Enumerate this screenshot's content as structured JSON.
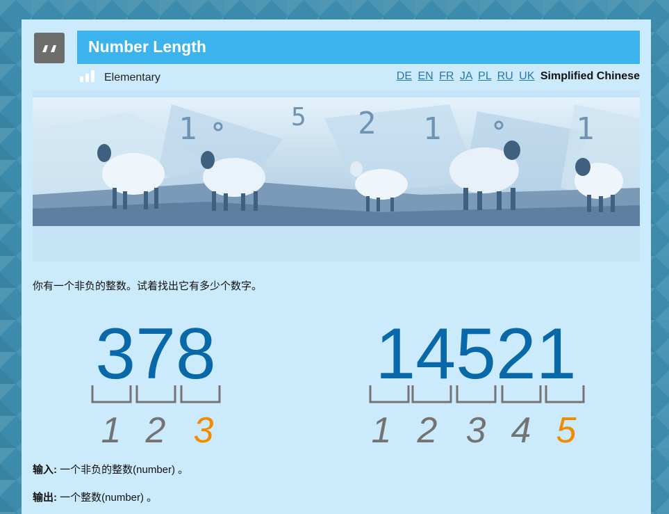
{
  "title": "Number Length",
  "level": "Elementary",
  "languages": [
    "DE",
    "EN",
    "FR",
    "JA",
    "PL",
    "RU",
    "UK"
  ],
  "current_language": "Simplified Chinese",
  "banner_digits": [
    "1",
    "5",
    "2",
    "1",
    "1"
  ],
  "description": "你有一个非负的整数。试着找出它有多少个数字。",
  "examples": [
    {
      "number": "378",
      "indices": [
        "1",
        "2",
        "3"
      ]
    },
    {
      "number": "14521",
      "indices": [
        "1",
        "2",
        "3",
        "4",
        "5"
      ]
    }
  ],
  "colors": {
    "number": "#0868a8",
    "index": "#737373",
    "last_index": "#f08c00",
    "title_bar": "#3db3ee"
  },
  "input": {
    "label": "输入:",
    "text": " 一个非负的整数(number) 。"
  },
  "output": {
    "label": "输出:",
    "text": " 一个整数(number) 。"
  }
}
